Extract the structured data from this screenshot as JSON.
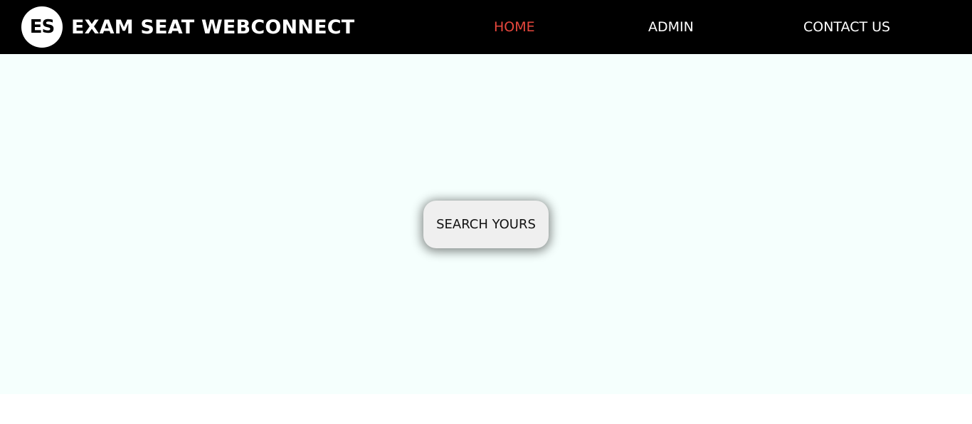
{
  "brand": {
    "logo_text": "ES",
    "title": "EXAM SEAT WEBCONNECT"
  },
  "nav": {
    "home": "HOME",
    "admin": "ADMIN",
    "contact": "CONTACT US"
  },
  "hero": {
    "search_button": "SEARCH YOURS"
  },
  "colors": {
    "navbar_bg": "#000000",
    "nav_text": "#ffffff",
    "nav_active": "#e8473d",
    "hero_bg": "#f5fffd",
    "button_bg": "#efefef"
  }
}
